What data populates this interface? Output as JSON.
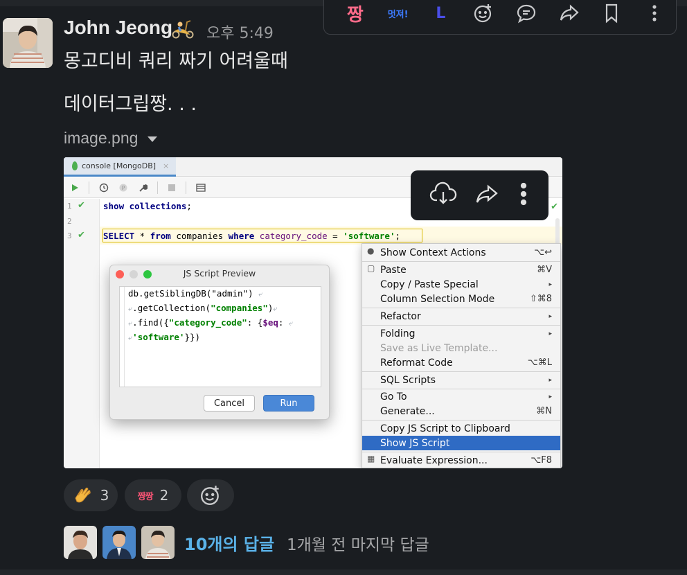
{
  "toolbar": {
    "emoji_jjang": "짱",
    "emoji_meotjyeo": "멋져!",
    "emoji_L": "L"
  },
  "message": {
    "author": "John Jeong",
    "timestamp": "오후 5:49",
    "line1": "몽고디비 쿼리 짜기 어려울때",
    "line2": "데이터그립짱. . .",
    "file_name": "image.png"
  },
  "ide": {
    "tab_label": "console [MongoDB]",
    "tab_close": "×",
    "line_numbers": [
      "1",
      "2",
      "3"
    ],
    "check": "✔",
    "code_line1_kw": "show collections",
    "code_line1_end": ";",
    "code_line3": {
      "select": "SELECT",
      "star": " * ",
      "from": "from",
      "table": " companies ",
      "where": "where",
      "column": " category_code",
      "eq": " = ",
      "value": "'software'",
      "end": ";"
    },
    "dialog": {
      "title": "JS Script Preview",
      "code1": "db.getSiblingDB(\"admin\")",
      "code2_a": ".getCollection(",
      "code2_b": "\"companies\"",
      "code2_c": ")",
      "code3_a": ".find({",
      "code3_b": "\"category_code\"",
      "code3_c": ": {",
      "code3_d": "$eq",
      "code3_e": ":",
      "code4_a": "'software'",
      "code4_b": "}})",
      "wrap_glyph": "⤶",
      "cancel": "Cancel",
      "run": "Run"
    },
    "context_menu": [
      {
        "label": "Show Context Actions",
        "shortcut": "⌥↩"
      },
      {
        "label": "Paste",
        "shortcut": "⌘V"
      },
      {
        "label": "Copy / Paste Special",
        "shortcut": "▸"
      },
      {
        "label": "Column Selection Mode",
        "shortcut": "⇧⌘8"
      },
      {
        "label": "Refactor",
        "shortcut": "▸"
      },
      {
        "label": "Folding",
        "shortcut": "▸"
      },
      {
        "label": "Save as Live Template...",
        "shortcut": ""
      },
      {
        "label": "Reformat Code",
        "shortcut": "⌥⌘L"
      },
      {
        "label": "SQL Scripts",
        "shortcut": "▸"
      },
      {
        "label": "Go To",
        "shortcut": "▸"
      },
      {
        "label": "Generate...",
        "shortcut": "⌘N"
      },
      {
        "label": "Copy JS Script to Clipboard",
        "shortcut": ""
      },
      {
        "label": "Show JS Script",
        "shortcut": ""
      },
      {
        "label": "Evaluate Expression...",
        "shortcut": "⌥F8"
      }
    ]
  },
  "reactions": [
    {
      "emoji": "clapping-hands",
      "count": "3"
    },
    {
      "emoji": "짱짱",
      "count": "2"
    }
  ],
  "replies": {
    "count_label": "10개의 답글",
    "last_reply": "1개월 전 마지막 답글"
  },
  "colors": {
    "background": "#1a1d21",
    "link": "#5ab2e8",
    "selected_menu": "#2f6bc4"
  }
}
